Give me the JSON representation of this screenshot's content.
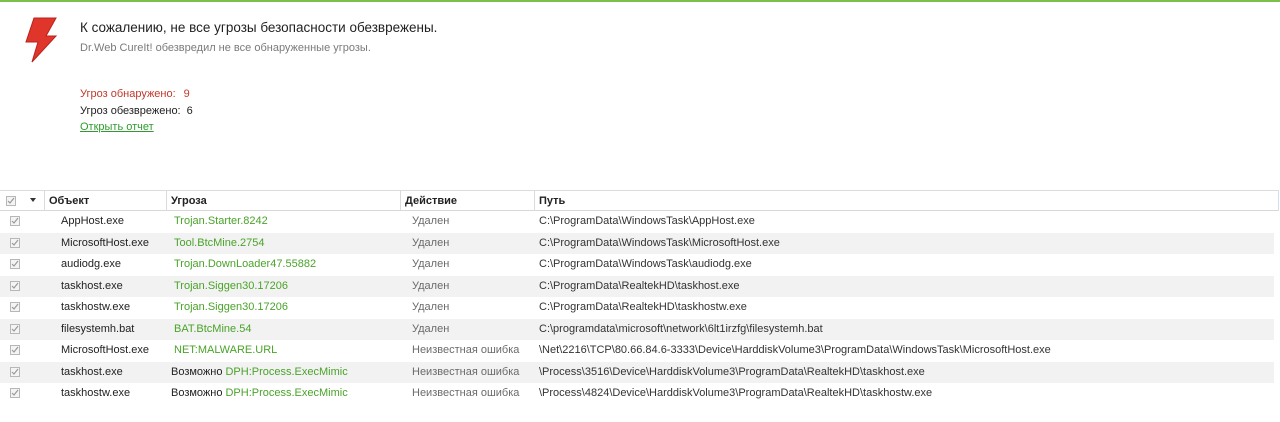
{
  "header": {
    "title": "К сожалению, не все угрозы безопасности обезврежены.",
    "subtitle": "Dr.Web CureIt! обезвредил не все обнаруженные угрозы."
  },
  "stats": {
    "found_label": "Угроз обнаружено:",
    "found_value": "9",
    "neutralized_label": "Угроз обезврежено:",
    "neutralized_value": "6",
    "report_link": "Открыть отчет"
  },
  "colors": {
    "accent": "#7cc04b",
    "threat_green": "#4aa329",
    "found_red": "#c0392b",
    "bolt_red": "#e0352b"
  },
  "table": {
    "columns": [
      "Объект",
      "Угроза",
      "Действие",
      "Путь"
    ],
    "rows": [
      {
        "checked": true,
        "object": "AppHost.exe",
        "prefix": "",
        "threat": "Trojan.Starter.8242",
        "action": "Удален",
        "path": "C:\\ProgramData\\WindowsTask\\AppHost.exe"
      },
      {
        "checked": true,
        "object": "MicrosoftHost.exe",
        "prefix": "",
        "threat": "Tool.BtcMine.2754",
        "action": "Удален",
        "path": "C:\\ProgramData\\WindowsTask\\MicrosoftHost.exe"
      },
      {
        "checked": true,
        "object": "audiodg.exe",
        "prefix": "",
        "threat": "Trojan.DownLoader47.55882",
        "action": "Удален",
        "path": "C:\\ProgramData\\WindowsTask\\audiodg.exe"
      },
      {
        "checked": true,
        "object": "taskhost.exe",
        "prefix": "",
        "threat": "Trojan.Siggen30.17206",
        "action": "Удален",
        "path": "C:\\ProgramData\\RealtekHD\\taskhost.exe"
      },
      {
        "checked": true,
        "object": "taskhostw.exe",
        "prefix": "",
        "threat": "Trojan.Siggen30.17206",
        "action": "Удален",
        "path": "C:\\ProgramData\\RealtekHD\\taskhostw.exe"
      },
      {
        "checked": true,
        "object": "filesystemh.bat",
        "prefix": "",
        "threat": "BAT.BtcMine.54",
        "action": "Удален",
        "path": "C:\\programdata\\microsoft\\network\\6lt1irzfg\\filesystemh.bat"
      },
      {
        "checked": true,
        "object": "MicrosoftHost.exe",
        "prefix": "",
        "threat": "NET:MALWARE.URL",
        "action": "Неизвестная ошибка",
        "path": "\\Net\\2216\\TCP\\80.66.84.6-3333\\Device\\HarddiskVolume3\\ProgramData\\WindowsTask\\MicrosoftHost.exe"
      },
      {
        "checked": true,
        "object": "taskhost.exe",
        "prefix": "Возможно",
        "threat": "DPH:Process.ExecMimic",
        "action": "Неизвестная ошибка",
        "path": "\\Process\\3516\\Device\\HarddiskVolume3\\ProgramData\\RealtekHD\\taskhost.exe"
      },
      {
        "checked": true,
        "object": "taskhostw.exe",
        "prefix": "Возможно",
        "threat": "DPH:Process.ExecMimic",
        "action": "Неизвестная ошибка",
        "path": "\\Process\\4824\\Device\\HarddiskVolume3\\ProgramData\\RealtekHD\\taskhostw.exe"
      }
    ]
  }
}
